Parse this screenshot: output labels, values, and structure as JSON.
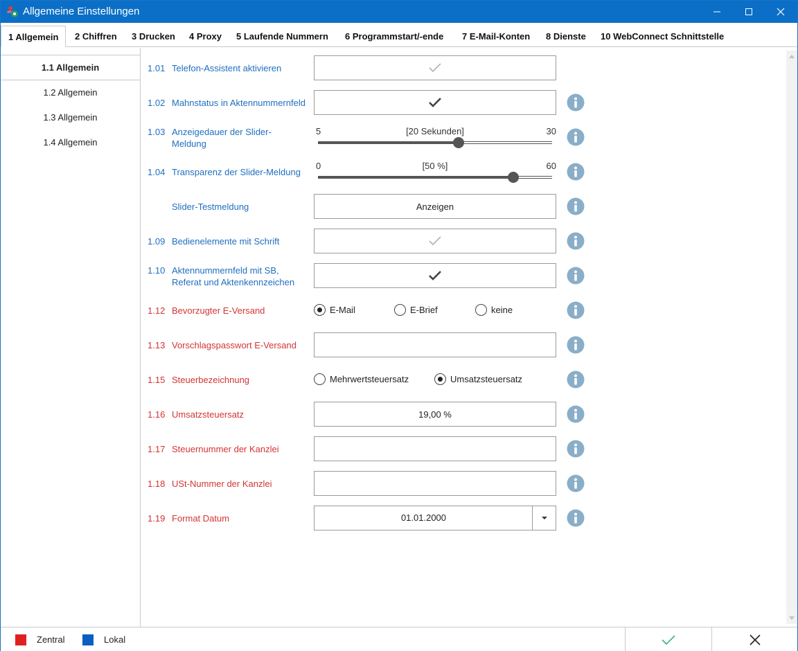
{
  "window": {
    "title": "Allgemeine Einstellungen",
    "titlebar_color": "#0b6fc7"
  },
  "tabs": [
    {
      "label": "1 Allgemein",
      "active": true
    },
    {
      "label": "2 Chiffren"
    },
    {
      "label": "3 Drucken"
    },
    {
      "label": "4 Proxy"
    },
    {
      "label": "5 Laufende Nummern"
    },
    {
      "label": "6 Programmstart/-ende"
    },
    {
      "label": "7 E-Mail-Konten"
    },
    {
      "label": "8 Dienste"
    },
    {
      "label": "10 WebConnect Schnittstelle"
    }
  ],
  "sidebar": {
    "items": [
      {
        "label": "1.1 Allgemein",
        "active": true
      },
      {
        "label": "1.2 Allgemein"
      },
      {
        "label": "1.3 Allgemein"
      },
      {
        "label": "1.4 Allgemein"
      }
    ]
  },
  "settings": {
    "s101": {
      "num": "1.01",
      "label": "Telefon-Assistent aktivieren",
      "scope": "Lokal",
      "checked": true,
      "disabled": true
    },
    "s102": {
      "num": "1.02",
      "label": "Mahnstatus in Aktennummernfeld",
      "scope": "Lokal",
      "checked": true
    },
    "s103": {
      "num": "1.03",
      "label_line1": "Anzeigedauer der Slider-",
      "label_line2": "Meldung",
      "scope": "Lokal",
      "min": "5",
      "max": "30",
      "value_text": "[20 Sekunden]",
      "value": 20,
      "range": [
        5,
        30
      ]
    },
    "s104": {
      "num": "1.04",
      "label": "Transparenz der Slider-Meldung",
      "scope": "Lokal",
      "min": "0",
      "max": "60",
      "value_text": "[50 %]",
      "value": 50,
      "range": [
        0,
        60
      ]
    },
    "slider_test": {
      "label": "Slider-Testmeldung",
      "button": "Anzeigen"
    },
    "s109": {
      "num": "1.09",
      "label": "Bedienelemente mit Schrift",
      "scope": "Lokal",
      "checked": true,
      "disabled": true
    },
    "s110": {
      "num": "1.10",
      "label_line1": "Aktennummernfeld mit SB,",
      "label_line2": "Referat und Aktenkennzeichen",
      "scope": "Lokal",
      "checked": true
    },
    "s112": {
      "num": "1.12",
      "label": "Bevorzugter E-Versand",
      "scope": "Zentral",
      "options": [
        "E-Mail",
        "E-Brief",
        "keine"
      ],
      "selected": "E-Mail"
    },
    "s113": {
      "num": "1.13",
      "label": "Vorschlagspasswort E-Versand",
      "scope": "Zentral",
      "value": ""
    },
    "s115": {
      "num": "1.15",
      "label": "Steuerbezeichnung",
      "scope": "Zentral",
      "options": [
        "Mehrwertsteuersatz",
        "Umsatzsteuersatz"
      ],
      "selected": "Umsatzsteuersatz"
    },
    "s116": {
      "num": "1.16",
      "label": "Umsatzsteuersatz",
      "scope": "Zentral",
      "value": "19,00 %"
    },
    "s117": {
      "num": "1.17",
      "label": "Steuernummer der Kanzlei",
      "scope": "Zentral",
      "value": ""
    },
    "s118": {
      "num": "1.18",
      "label": "USt-Nummer der Kanzlei",
      "scope": "Zentral",
      "value": ""
    },
    "s119": {
      "num": "1.19",
      "label": "Format Datum",
      "scope": "Zentral",
      "value": "01.01.2000"
    }
  },
  "footer": {
    "legend": [
      {
        "label": "Zentral",
        "color": "#e02020"
      },
      {
        "label": "Lokal",
        "color": "#0b5fc0"
      }
    ],
    "ok_icon": "check-icon",
    "cancel_icon": "close-icon"
  },
  "colors": {
    "zentral": "#d33434",
    "lokal": "#1f6fbf",
    "info_icon": "#8aaec8"
  }
}
